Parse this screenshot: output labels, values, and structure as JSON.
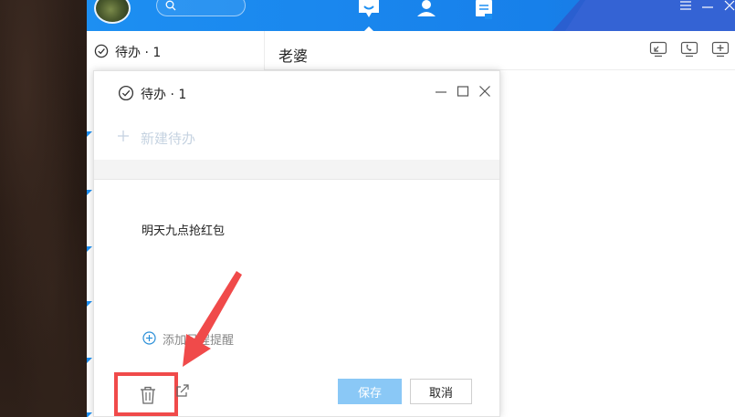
{
  "sidebar": {
    "todo_label": "待办 · 1"
  },
  "chat": {
    "title": "老婆",
    "tools": [
      "screen-share-icon",
      "phone-icon",
      "add-icon"
    ]
  },
  "nav": {
    "icons": [
      "message-icon",
      "contacts-icon",
      "document-icon"
    ],
    "active": "message-icon"
  },
  "popup": {
    "title": "待办 · 1",
    "new_todo_placeholder": "新建待办",
    "todo_text": "明天九点抢红包",
    "reminder_label": "添加日程提醒",
    "save_label": "保存",
    "cancel_label": "取消"
  },
  "colors": {
    "topbar": "#1d8ff2",
    "accent": "#1d8ff2",
    "save_button": "#8ac8f6",
    "annotation": "#f04a4a"
  }
}
